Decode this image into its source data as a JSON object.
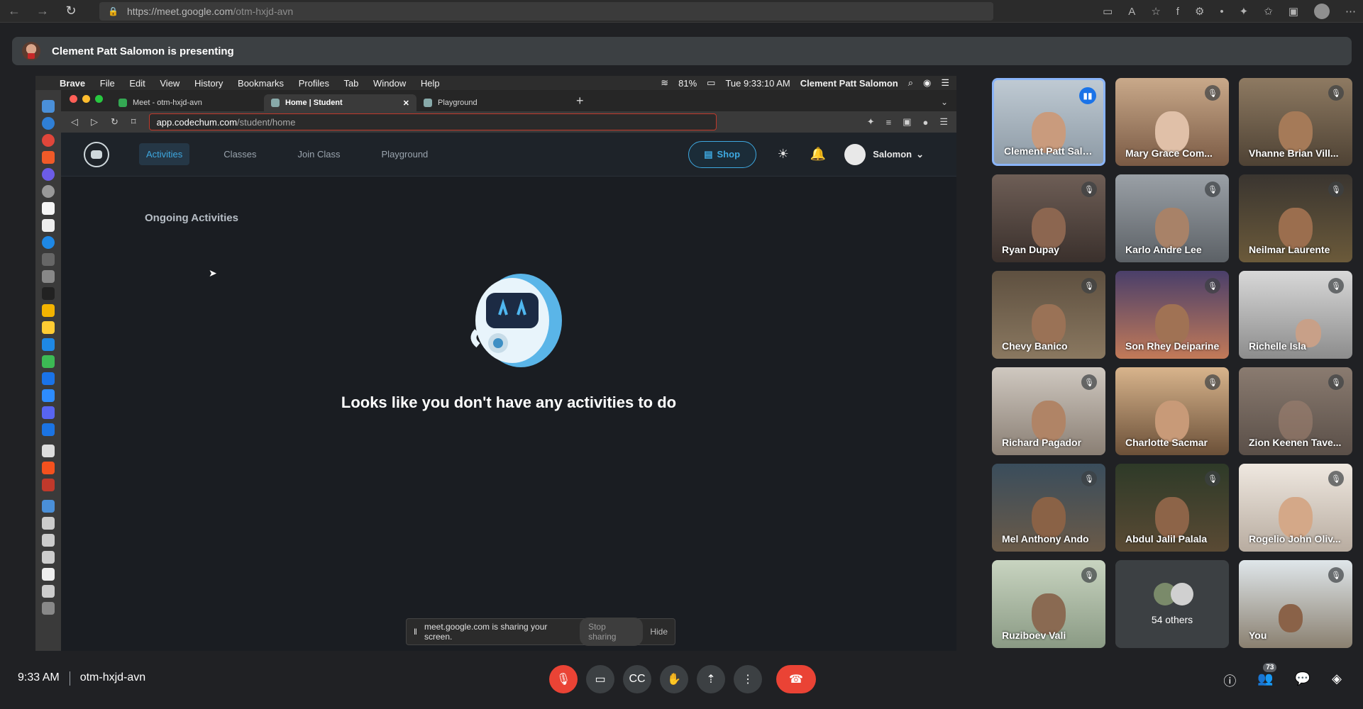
{
  "browser": {
    "url_host": "https://meet.google.com",
    "url_path": "/otm-hxjd-avn",
    "back_icon": "arrow-left-icon",
    "forward_icon": "arrow-right-icon",
    "reload_icon": "reload-icon"
  },
  "banner": {
    "text": "Clement Patt Salomon is presenting"
  },
  "shared_screen": {
    "mac_menu": {
      "app": "Brave",
      "items": [
        "File",
        "Edit",
        "View",
        "History",
        "Bookmarks",
        "Profiles",
        "Tab",
        "Window",
        "Help"
      ],
      "battery": "81%",
      "clock": "Tue 9:33:10 AM",
      "user": "Clement Patt Salomon"
    },
    "tabs": [
      {
        "label": "Meet - otm-hxjd-avn"
      },
      {
        "label": "Home | Student"
      },
      {
        "label": "Playground"
      }
    ],
    "address": {
      "host": "app.codechum.com",
      "path": "/student/home"
    },
    "app_nav": {
      "links": [
        "Activities",
        "Classes",
        "Join Class",
        "Playground"
      ],
      "shop": "Shop",
      "user": "Salomon"
    },
    "section_title": "Ongoing Activities",
    "empty_message": "Looks like you don't have any activities to do",
    "share_notice": {
      "text": "meet.google.com is sharing your screen.",
      "stop": "Stop sharing",
      "hide": "Hide"
    }
  },
  "participants": [
    {
      "name": "Clement Patt Salo...",
      "speaking": true
    },
    {
      "name": "Mary Grace Com..."
    },
    {
      "name": "Vhanne Brian Vill..."
    },
    {
      "name": "Ryan Dupay"
    },
    {
      "name": "Karlo Andre Lee"
    },
    {
      "name": "Neilmar Laurente"
    },
    {
      "name": "Chevy Banico"
    },
    {
      "name": "Son Rhey Deiparine"
    },
    {
      "name": "Richelle Isla"
    },
    {
      "name": "Richard Pagador"
    },
    {
      "name": "Charlotte Sacmar"
    },
    {
      "name": "Zion Keenen Tave..."
    },
    {
      "name": "Mel Anthony Ando"
    },
    {
      "name": "Abdul Jalil Palala"
    },
    {
      "name": "Rogelio John Oliv..."
    },
    {
      "name": "Ruziboev Vali"
    },
    {
      "name": "54 others"
    },
    {
      "name": "You"
    }
  ],
  "bottom": {
    "time": "9:33 AM",
    "meeting_code": "otm-hxjd-avn",
    "people_count": "73"
  },
  "colors": {
    "accent": "#3ea8e0",
    "end_call": "#ea4335",
    "speaking": "#8ab4f8"
  }
}
